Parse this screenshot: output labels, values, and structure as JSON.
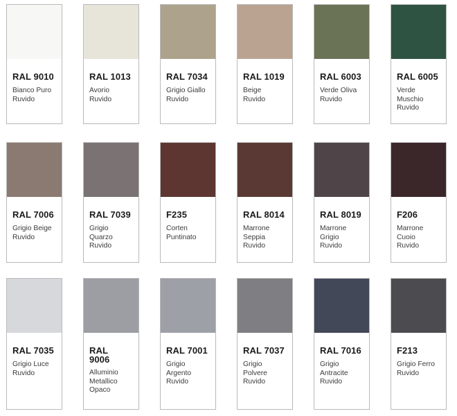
{
  "swatches": [
    {
      "code": "RAL 9010",
      "name": [
        "Bianco Puro",
        "Ruvido"
      ],
      "color": "#f7f7f5"
    },
    {
      "code": "RAL 1013",
      "name": [
        "Avorio",
        "Ruvido"
      ],
      "color": "#e7e5d9"
    },
    {
      "code": "RAL 7034",
      "name": [
        "Grigio Giallo",
        "Ruvido"
      ],
      "color": "#ada28b"
    },
    {
      "code": "RAL 1019",
      "name": [
        "Beige",
        "Ruvido"
      ],
      "color": "#bba392"
    },
    {
      "code": "RAL 6003",
      "name": [
        "Verde Oliva",
        "Ruvido"
      ],
      "color": "#6b7356"
    },
    {
      "code": "RAL 6005",
      "name": [
        "Verde",
        "Muschio",
        "Ruvido"
      ],
      "color": "#2e5342"
    },
    {
      "code": "RAL 7006",
      "name": [
        "Grigio Beige",
        "Ruvido"
      ],
      "color": "#8a7a71"
    },
    {
      "code": "RAL 7039",
      "name": [
        "Grigio",
        "Quarzo",
        "Ruvido"
      ],
      "color": "#7a7273"
    },
    {
      "code": "F235",
      "name": [
        "Corten",
        "Puntinato"
      ],
      "color": "#5e3631"
    },
    {
      "code": "RAL 8014",
      "name": [
        "Marrone",
        "Seppia",
        "Ruvido"
      ],
      "color": "#5a3935"
    },
    {
      "code": "RAL 8019",
      "name": [
        "Marrone",
        "Grigio",
        "Ruvido"
      ],
      "color": "#4f4549"
    },
    {
      "code": "F206",
      "name": [
        "Marrone",
        "Cuoio",
        "Ruvido"
      ],
      "color": "#3b2629"
    },
    {
      "code": "RAL 7035",
      "name": [
        "Grigio Luce",
        "Ruvido"
      ],
      "color": "#d7d8dc"
    },
    {
      "code": "RAL 9006",
      "name": [
        "Alluminio",
        "Metallico",
        "Opaco"
      ],
      "color": "#9c9ea3",
      "code_lines": [
        "RAL",
        "9006"
      ]
    },
    {
      "code": "RAL 7001",
      "name": [
        "Grigio",
        "Argento",
        "Ruvido"
      ],
      "color": "#9ea0a8"
    },
    {
      "code": "RAL 7037",
      "name": [
        "Grigio",
        "Polvere",
        "Ruvido"
      ],
      "color": "#7f7f83"
    },
    {
      "code": "RAL 7016",
      "name": [
        "Grigio",
        "Antracite",
        "Ruvido"
      ],
      "color": "#434859"
    },
    {
      "code": "F213",
      "name": [
        "Grigio Ferro",
        "Ruvido"
      ],
      "color": "#4c4c50"
    }
  ]
}
